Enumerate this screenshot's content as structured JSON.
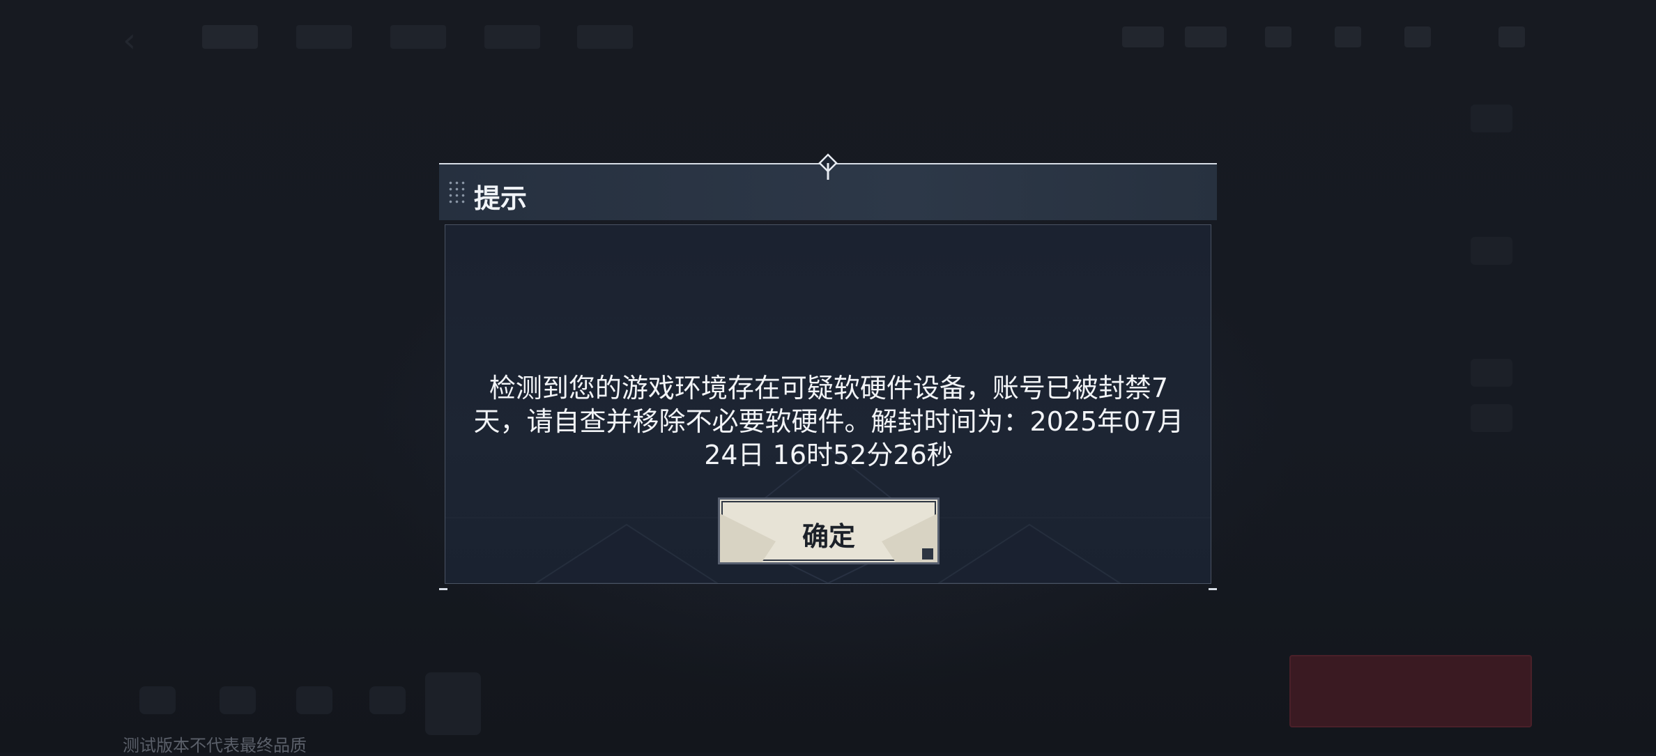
{
  "background": {
    "nav_items": [
      "",
      "",
      "",
      "",
      ""
    ],
    "version_note": "测试版本不代表最终品质"
  },
  "dialog": {
    "title": "提示",
    "message": "检测到您的游戏环境存在可疑软硬件设备，账号已被封禁7天，请自查并移除不必要软硬件。解封时间为：2025年07月24日 16时52分26秒",
    "confirm_label": "确定"
  },
  "colors": {
    "backdrop": "#15181f",
    "dialog_header": "#2d3848",
    "dialog_body": "#1d2533",
    "button_face": "#e7e3d6",
    "text_primary": "#f2f4f7"
  }
}
